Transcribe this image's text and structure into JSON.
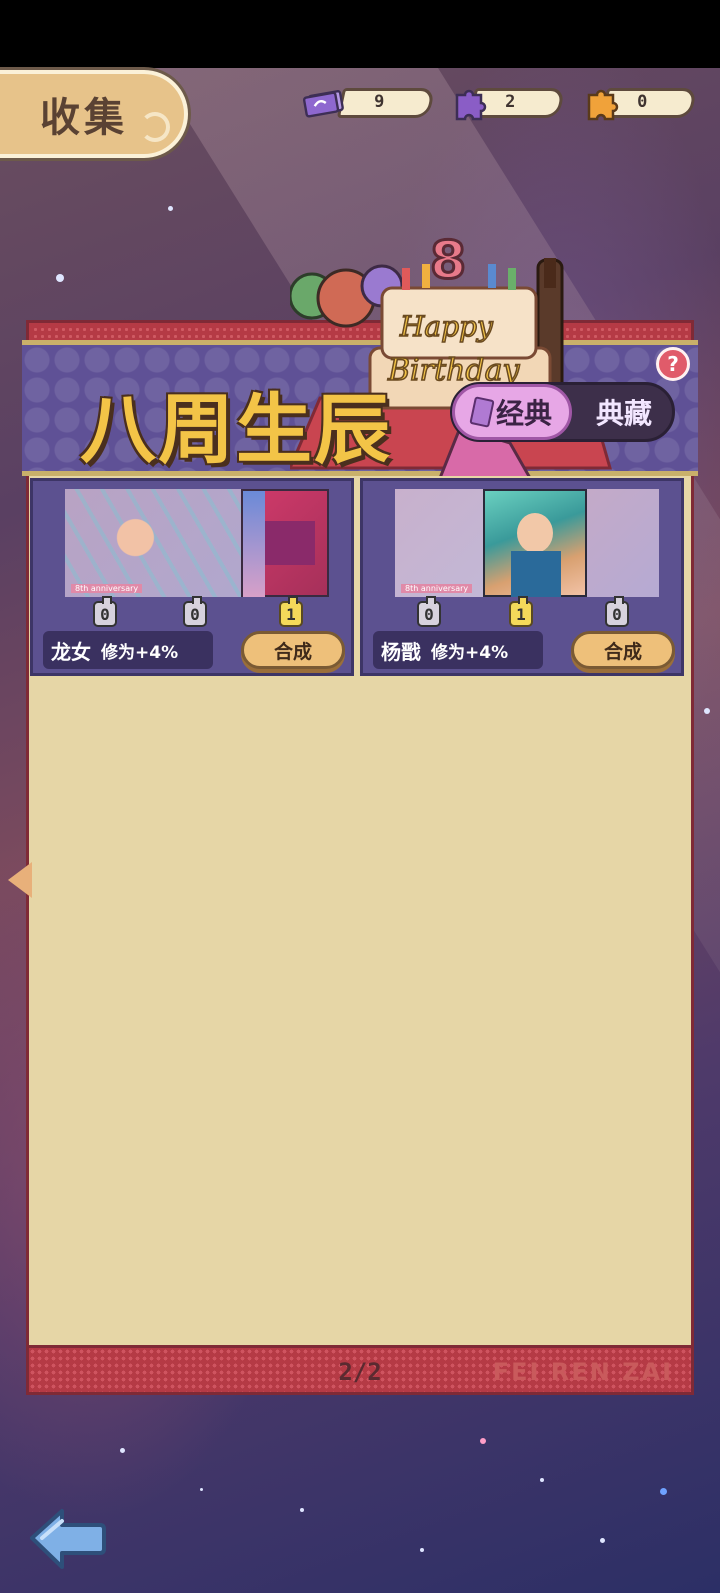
{
  "header": {
    "title": "收集"
  },
  "currencies": [
    {
      "icon": "ticket-icon",
      "value": "9",
      "color": "#9b6fd0"
    },
    {
      "icon": "puzzle-purple-icon",
      "value": "2",
      "color": "#8a5dc6"
    },
    {
      "icon": "puzzle-orange-icon",
      "value": "0",
      "color": "#f0a23a"
    }
  ],
  "banner": {
    "title": "八周生辰",
    "tabs": [
      {
        "label": "经典",
        "selected": true
      },
      {
        "label": "典藏",
        "selected": false
      }
    ],
    "help": "?"
  },
  "cards": [
    {
      "name": "龙女",
      "bonus": "修为+4%",
      "pieces": [
        "0",
        "0",
        "1"
      ],
      "button": "合成",
      "art_label": "8th anniversary"
    },
    {
      "name": "杨戬",
      "bonus": "修为+4%",
      "pieces": [
        "0",
        "1",
        "0"
      ],
      "button": "合成",
      "art_label": "8th anniversary"
    }
  ],
  "footer": {
    "page": "2/2",
    "brand": "FEI REN ZAI"
  },
  "colors": {
    "accent_gold": "#f3c447",
    "board": "#e6d6a6",
    "frame_red": "#b53a45",
    "card_purple": "#5c5190"
  }
}
